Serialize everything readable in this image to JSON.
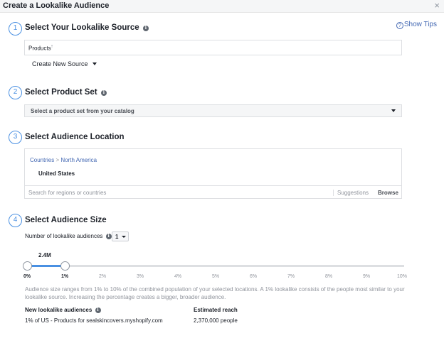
{
  "dialog": {
    "title": "Create a Lookalike Audience",
    "close_icon": "×",
    "show_tips": "Show Tips"
  },
  "steps": [
    {
      "number": "1",
      "title": "Select Your Lookalike Source"
    },
    {
      "number": "2",
      "title": "Select Product Set"
    },
    {
      "number": "3",
      "title": "Select Audience Location"
    },
    {
      "number": "4",
      "title": "Select Audience Size"
    }
  ],
  "source": {
    "value": "Products",
    "marker": "†",
    "create_new": "Create New Source"
  },
  "product_set": {
    "placeholder": "Select a product set from your catalog"
  },
  "location": {
    "crumb_countries": "Countries",
    "crumb_sep": ">",
    "crumb_region": "North America",
    "country": "United States",
    "search_placeholder": "Search for regions or countries",
    "suggestions": "Suggestions",
    "browse": "Browse"
  },
  "size": {
    "num_label": "Number of lookalike audiences",
    "num_value": "1",
    "reach_label": "2.4M",
    "range_start_pct": 0,
    "range_end_pct": 1,
    "ticks": [
      "0%",
      "1%",
      "2%",
      "3%",
      "4%",
      "5%",
      "6%",
      "7%",
      "8%",
      "9%",
      "10%"
    ],
    "help": "Audience size ranges from 1% to 10% of the combined population of your selected locations. A 1% lookalike consists of the people most similar to your lookalike source. Increasing the percentage creates a bigger, broader audience."
  },
  "results": {
    "col_audience": "New lookalike audiences",
    "col_reach": "Estimated reach",
    "rows": [
      {
        "audience": "1% of US - Products for sealskincovers.myshopify.com",
        "reach": "2,370,000 people"
      }
    ]
  },
  "colors": {
    "accent": "#4a90e2",
    "link": "#4267b2"
  }
}
